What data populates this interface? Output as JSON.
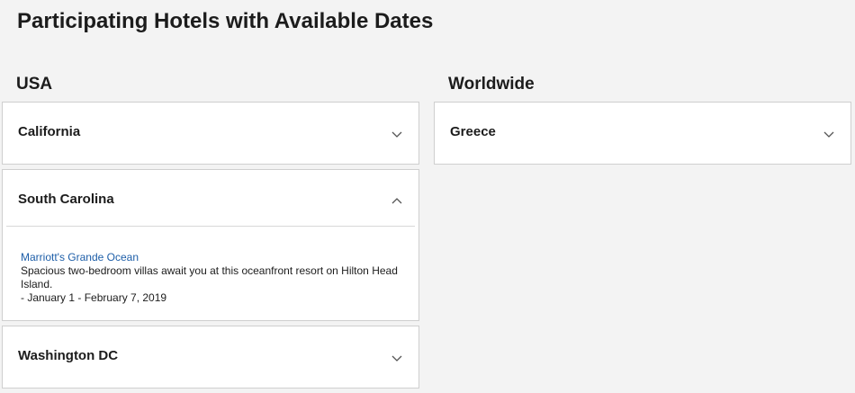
{
  "page": {
    "title": "Participating Hotels with Available Dates"
  },
  "usa": {
    "heading": "USA",
    "items": [
      {
        "label": "California",
        "expanded": false
      },
      {
        "label": "South Carolina",
        "expanded": true,
        "hotel": {
          "name": "Marriott's Grande Ocean",
          "description": "Spacious two-bedroom villas await you at this oceanfront resort on Hilton Head Island.",
          "dates": "- January 1 - February 7, 2019"
        }
      },
      {
        "label": "Washington DC",
        "expanded": false
      }
    ]
  },
  "worldwide": {
    "heading": "Worldwide",
    "items": [
      {
        "label": "Greece",
        "expanded": false
      }
    ]
  },
  "icons": {
    "collapsed": "chevron-down-icon",
    "expanded": "chevron-up-icon"
  },
  "colors": {
    "background": "#f3f3f3",
    "card": "#ffffff",
    "border": "#cfcfcf",
    "link": "#1d5ea8",
    "text": "#1c1c1c"
  }
}
